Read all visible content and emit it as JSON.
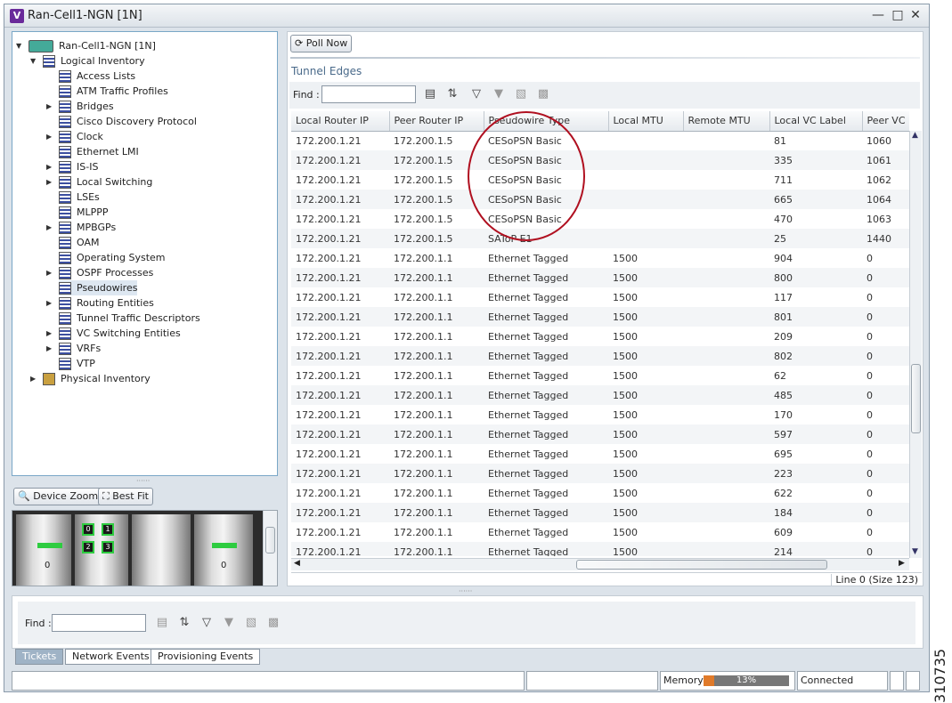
{
  "window": {
    "title": "Ran-Cell1-NGN [1N]",
    "app_icon_letter": "V"
  },
  "tree": {
    "root": "Ran-Cell1-NGN [1N]",
    "logical": "Logical Inventory",
    "items": [
      "Access Lists",
      "ATM Traffic Profiles",
      "Bridges",
      "Cisco Discovery Protocol",
      "Clock",
      "Ethernet LMI",
      "IS-IS",
      "Local Switching",
      "LSEs",
      "MLPPP",
      "MPBGPs",
      "OAM",
      "Operating System",
      "OSPF Processes",
      "Pseudowires",
      "Routing Entities",
      "Tunnel Traffic Descriptors",
      "VC Switching Entities",
      "VRFs",
      "VTP"
    ],
    "expandable": [
      false,
      false,
      true,
      false,
      true,
      false,
      true,
      true,
      false,
      false,
      true,
      false,
      false,
      true,
      false,
      true,
      false,
      true,
      true,
      false
    ],
    "selected_index": 14,
    "physical": "Physical Inventory"
  },
  "zoom": {
    "device_zoom": "Device Zoom",
    "best_fit": "Best Fit",
    "slot_left": "0",
    "slot_right": "0",
    "ports": [
      "0",
      "1",
      "2",
      "3"
    ]
  },
  "toolbar": {
    "poll_now": "Poll Now"
  },
  "section": {
    "title": "Tunnel Edges",
    "find_label": "Find :"
  },
  "table": {
    "columns": [
      "Local Router IP",
      "Peer Router IP",
      "Pseudowire Type",
      "Local MTU",
      "Remote MTU",
      "Local VC Label",
      "Peer VC"
    ],
    "rows": [
      [
        "172.200.1.21",
        "172.200.1.5",
        "CESoPSN Basic",
        "",
        "",
        "81",
        "1060"
      ],
      [
        "172.200.1.21",
        "172.200.1.5",
        "CESoPSN Basic",
        "",
        "",
        "335",
        "1061"
      ],
      [
        "172.200.1.21",
        "172.200.1.5",
        "CESoPSN Basic",
        "",
        "",
        "711",
        "1062"
      ],
      [
        "172.200.1.21",
        "172.200.1.5",
        "CESoPSN Basic",
        "",
        "",
        "665",
        "1064"
      ],
      [
        "172.200.1.21",
        "172.200.1.5",
        "CESoPSN Basic",
        "",
        "",
        "470",
        "1063"
      ],
      [
        "172.200.1.21",
        "172.200.1.5",
        "SAToP E1",
        "",
        "",
        "25",
        "1440"
      ],
      [
        "172.200.1.21",
        "172.200.1.1",
        "Ethernet Tagged",
        "1500",
        "",
        "904",
        "0"
      ],
      [
        "172.200.1.21",
        "172.200.1.1",
        "Ethernet Tagged",
        "1500",
        "",
        "800",
        "0"
      ],
      [
        "172.200.1.21",
        "172.200.1.1",
        "Ethernet Tagged",
        "1500",
        "",
        "117",
        "0"
      ],
      [
        "172.200.1.21",
        "172.200.1.1",
        "Ethernet Tagged",
        "1500",
        "",
        "801",
        "0"
      ],
      [
        "172.200.1.21",
        "172.200.1.1",
        "Ethernet Tagged",
        "1500",
        "",
        "209",
        "0"
      ],
      [
        "172.200.1.21",
        "172.200.1.1",
        "Ethernet Tagged",
        "1500",
        "",
        "802",
        "0"
      ],
      [
        "172.200.1.21",
        "172.200.1.1",
        "Ethernet Tagged",
        "1500",
        "",
        "62",
        "0"
      ],
      [
        "172.200.1.21",
        "172.200.1.1",
        "Ethernet Tagged",
        "1500",
        "",
        "485",
        "0"
      ],
      [
        "172.200.1.21",
        "172.200.1.1",
        "Ethernet Tagged",
        "1500",
        "",
        "170",
        "0"
      ],
      [
        "172.200.1.21",
        "172.200.1.1",
        "Ethernet Tagged",
        "1500",
        "",
        "597",
        "0"
      ],
      [
        "172.200.1.21",
        "172.200.1.1",
        "Ethernet Tagged",
        "1500",
        "",
        "695",
        "0"
      ],
      [
        "172.200.1.21",
        "172.200.1.1",
        "Ethernet Tagged",
        "1500",
        "",
        "223",
        "0"
      ],
      [
        "172.200.1.21",
        "172.200.1.1",
        "Ethernet Tagged",
        "1500",
        "",
        "622",
        "0"
      ],
      [
        "172.200.1.21",
        "172.200.1.1",
        "Ethernet Tagged",
        "1500",
        "",
        "184",
        "0"
      ],
      [
        "172.200.1.21",
        "172.200.1.1",
        "Ethernet Tagged",
        "1500",
        "",
        "609",
        "0"
      ],
      [
        "172.200.1.21",
        "172.200.1.1",
        "Ethernet Tagged",
        "1500",
        "",
        "214",
        "0"
      ]
    ],
    "status": "Line 0 (Size 123)"
  },
  "bottom": {
    "find_label": "Find :",
    "tabs": [
      "Tickets",
      "Network Events",
      "Provisioning Events"
    ],
    "active_tab": 0
  },
  "statusbar": {
    "memory_label": "Memory:",
    "memory_value": "13%",
    "memory_fraction": 0.13,
    "connection": "Connected"
  },
  "figure_id": "310735",
  "colors": {
    "selection": "#dde7f1",
    "memory_bar": "#e07a2a",
    "highlight_circle": "#b01020"
  }
}
